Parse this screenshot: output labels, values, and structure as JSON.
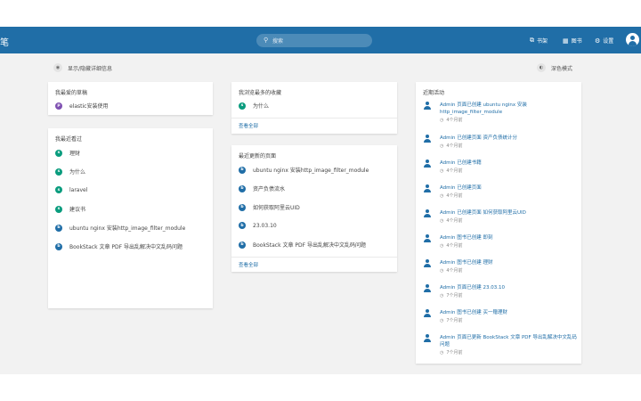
{
  "header": {
    "brand": "笔",
    "search_placeholder": "搜索",
    "nav": [
      {
        "icon": "shelf-icon",
        "glyph": "⧉",
        "label": "书架"
      },
      {
        "icon": "books-icon",
        "glyph": "▦",
        "label": "图书"
      },
      {
        "icon": "settings-icon",
        "glyph": "⚙",
        "label": "设置"
      }
    ],
    "accent": "#206ea7"
  },
  "toolbar": {
    "toggle_details": "显示/隐藏详细信息",
    "dark_mode": "深色模式"
  },
  "favorites": {
    "title": "我最爱的草稿",
    "items": [
      {
        "type": "page",
        "label": "elastic安装使用"
      }
    ]
  },
  "recently_viewed": {
    "title": "我最近看过",
    "items": [
      {
        "type": "shelf",
        "label": "理财"
      },
      {
        "type": "shelf",
        "label": "为什么"
      },
      {
        "type": "shelf",
        "label": "laravel"
      },
      {
        "type": "shelf",
        "label": "建议书"
      },
      {
        "type": "book",
        "label": "ubuntu nginx 安装http_image_filter_module"
      },
      {
        "type": "book",
        "label": "BookStack 文章 PDF 导出乱解决中文乱码问题"
      }
    ]
  },
  "popular": {
    "title": "我浏览最多的收藏",
    "items": [
      {
        "type": "shelf",
        "label": "为什么"
      }
    ],
    "more": "查看全部"
  },
  "recent_pages": {
    "title": "最近更新的页面",
    "items": [
      {
        "type": "book",
        "label": "ubuntu nginx 安装http_image_filter_module"
      },
      {
        "type": "book",
        "label": "资产负债流水"
      },
      {
        "type": "book",
        "label": "如何获取阿里云UID"
      },
      {
        "type": "book",
        "label": "23.03.10"
      },
      {
        "type": "book",
        "label": "BookStack 文章 PDF 导出乱解决中文乱码问题"
      }
    ],
    "more": "查看全部"
  },
  "activity": {
    "title": "近期活动",
    "items": [
      {
        "text": "Admin 页面已创建 ubuntu nginx 安装 http_image_filter_module",
        "time": "4个月前"
      },
      {
        "text": "Admin 已创建页面 资产负债统计分",
        "time": "4个月前"
      },
      {
        "text": "Admin 已创建书籍",
        "time": "4个月前"
      },
      {
        "text": "Admin 已创建页面",
        "time": "4个月前"
      },
      {
        "text": "Admin 已创建页面 如何获取阿里云UID",
        "time": "4个月前"
      },
      {
        "text": "Admin 图书已创建 即刻",
        "time": "4个月前"
      },
      {
        "text": "Admin 图书已创建 理财",
        "time": "4个月前"
      },
      {
        "text": "Admin 页面已创建 23.03.10",
        "time": "7个月前"
      },
      {
        "text": "Admin 图书已创建 买一赠理财",
        "time": "7个月前"
      },
      {
        "text": "Admin 页面已更新 BookStack 文章 PDF 导出乱解决中文乱码 问题",
        "time": "7个月前"
      }
    ]
  }
}
